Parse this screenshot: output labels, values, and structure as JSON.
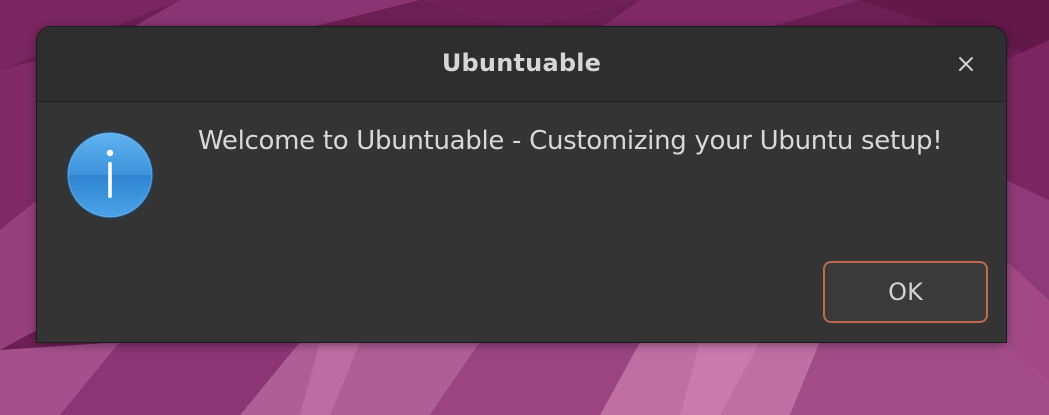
{
  "dialog": {
    "title": "Ubuntuable",
    "close_icon": "close-icon",
    "message_icon": "info-icon",
    "message": "Welcome to Ubuntuable - Customizing your Ubuntu setup!",
    "ok_label": "OK"
  },
  "colors": {
    "desktop_background": "#6a1f52",
    "dialog_background": "#363636",
    "titlebar_background": "#2e2e2e",
    "accent_border": "#c06a4c",
    "info_icon_blue": "#3f98df"
  }
}
